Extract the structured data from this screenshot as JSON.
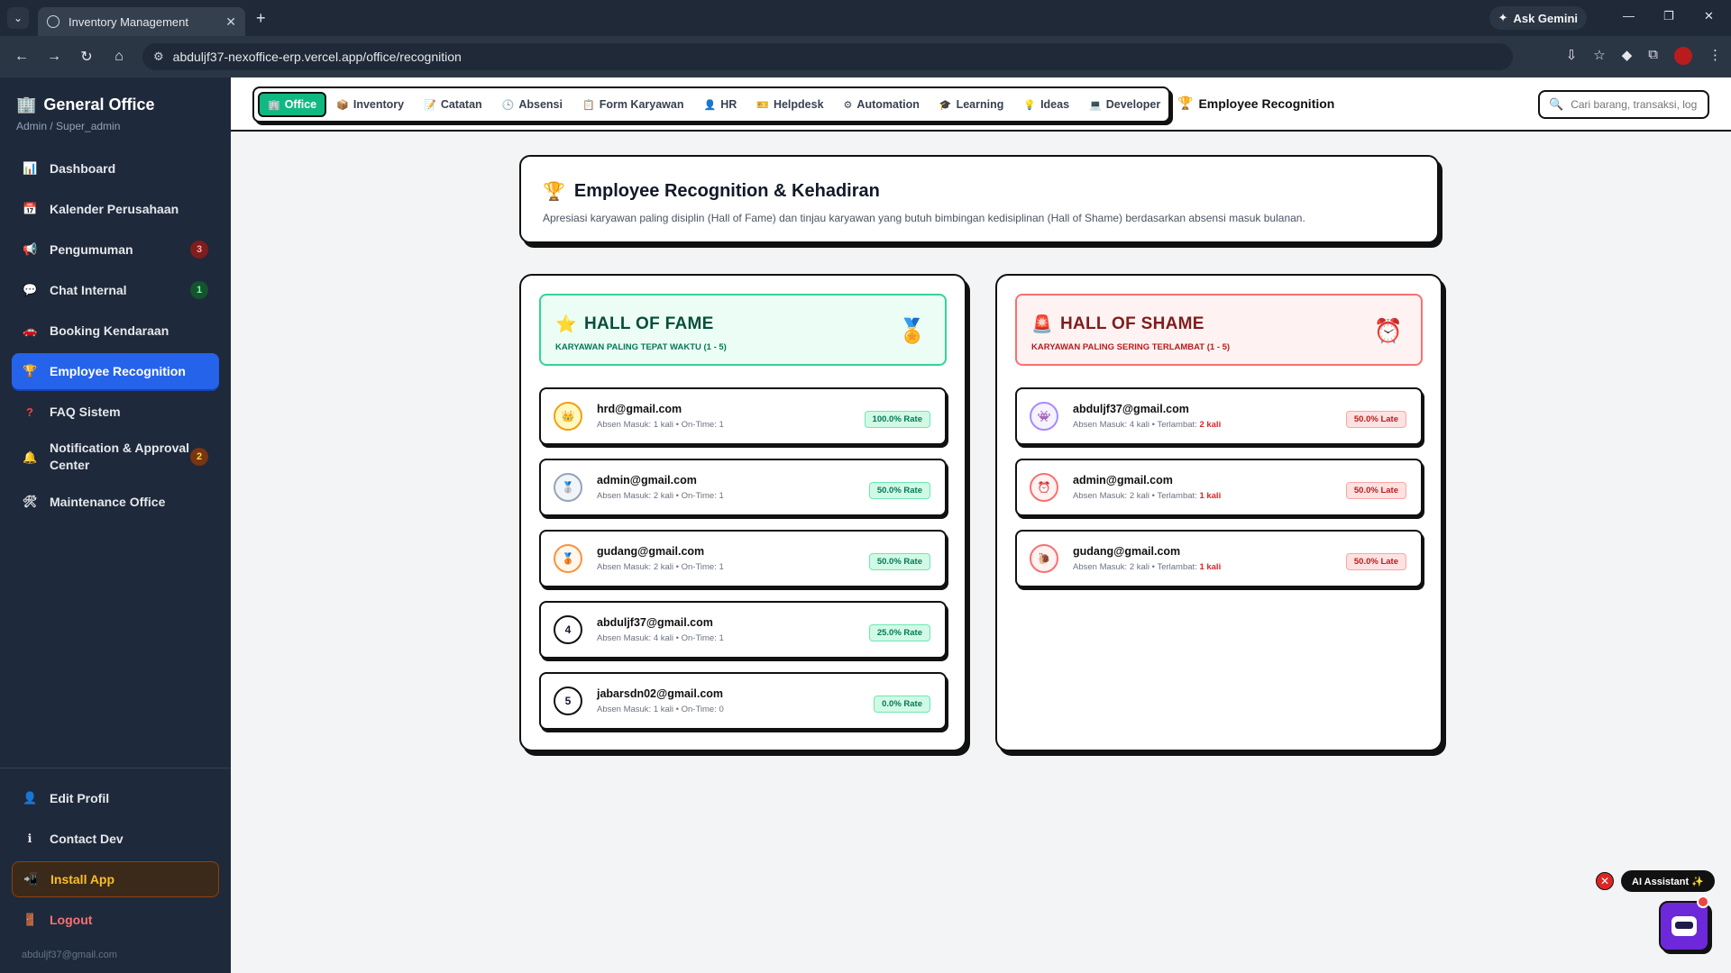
{
  "browser": {
    "tab_title": "Inventory Management",
    "url": "abduljf37-nexoffice-erp.vercel.app/office/recognition",
    "gemini": "Ask Gemini"
  },
  "sidebar": {
    "brand": "General Office",
    "role": "Admin / Super_admin",
    "items": [
      {
        "label": "Dashboard"
      },
      {
        "label": "Kalender Perusahaan"
      },
      {
        "label": "Pengumuman",
        "badge": "3"
      },
      {
        "label": "Chat Internal",
        "badge": "1"
      },
      {
        "label": "Booking Kendaraan"
      },
      {
        "label": "Employee Recognition"
      },
      {
        "label": "FAQ Sistem"
      },
      {
        "label": "Notification & Approval Center",
        "badge": "2"
      },
      {
        "label": "Maintenance Office"
      }
    ],
    "bottom": {
      "edit_profile": "Edit Profil",
      "contact_dev": "Contact Dev",
      "install": "Install App",
      "logout": "Logout",
      "email": "abduljf37@gmail.com"
    }
  },
  "topbar": {
    "modules": [
      "Office",
      "Inventory",
      "Catatan",
      "Absensi",
      "Form Karyawan",
      "HR",
      "Helpdesk",
      "Automation",
      "Learning",
      "Ideas",
      "Developer"
    ],
    "current_page": "Employee Recognition",
    "search_placeholder": "Cari barang, transaksi, log..."
  },
  "hero": {
    "title": "Employee Recognition & Kehadiran",
    "description": "Apresiasi karyawan paling disiplin (Hall of Fame) dan tinjau karyawan yang butuh bimbingan kedisiplinan (Hall of Shame) berdasarkan absensi masuk bulanan."
  },
  "fame": {
    "title": "HALL OF FAME",
    "subtitle": "KARYAWAN PALING TEPAT WAKTU (1 - 5)",
    "rows": [
      {
        "rank": "👑",
        "email": "hrd@gmail.com",
        "meta": "Absen Masuk: 1 kali • On-Time: 1",
        "rate": "100.0% Rate"
      },
      {
        "rank": "🥈",
        "email": "admin@gmail.com",
        "meta": "Absen Masuk: 2 kali • On-Time: 1",
        "rate": "50.0% Rate"
      },
      {
        "rank": "🥉",
        "email": "gudang@gmail.com",
        "meta": "Absen Masuk: 2 kali • On-Time: 1",
        "rate": "50.0% Rate"
      },
      {
        "rank": "4",
        "email": "abduljf37@gmail.com",
        "meta": "Absen Masuk: 4 kali • On-Time: 1",
        "rate": "25.0% Rate"
      },
      {
        "rank": "5",
        "email": "jabarsdn02@gmail.com",
        "meta": "Absen Masuk: 1 kali • On-Time: 0",
        "rate": "0.0% Rate"
      }
    ]
  },
  "shame": {
    "title": "HALL OF SHAME",
    "subtitle": "KARYAWAN PALING SERING TERLAMBAT (1 - 5)",
    "rows": [
      {
        "rank": "👾",
        "email": "abduljf37@gmail.com",
        "meta": "Absen Masuk: 4 kali • Terlambat:",
        "late": "2 kali",
        "rate": "50.0% Late"
      },
      {
        "rank": "⏰",
        "email": "admin@gmail.com",
        "meta": "Absen Masuk: 2 kali • Terlambat:",
        "late": "1 kali",
        "rate": "50.0% Late"
      },
      {
        "rank": "🐌",
        "email": "gudang@gmail.com",
        "meta": "Absen Masuk: 2 kali • Terlambat:",
        "late": "1 kali",
        "rate": "50.0% Late"
      }
    ]
  },
  "assistant": {
    "label": "AI Assistant ✨",
    "close": "✕"
  }
}
